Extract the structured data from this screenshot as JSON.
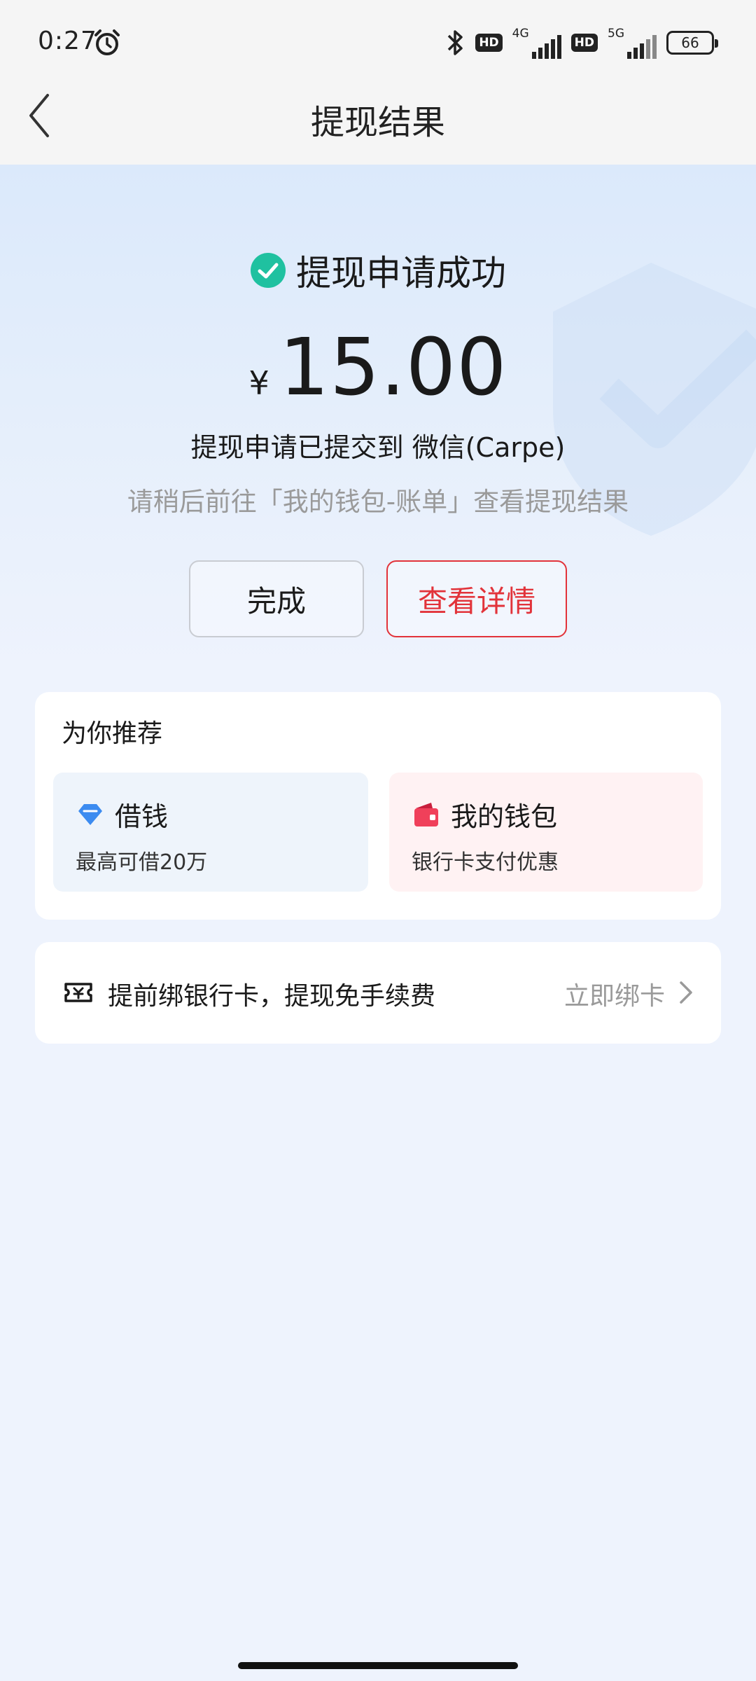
{
  "status_bar": {
    "time": "0:27",
    "hd1": "HD",
    "net1": "4G",
    "hd2": "HD",
    "net2": "5G",
    "battery": "66"
  },
  "nav": {
    "title": "提现结果"
  },
  "result": {
    "status_text": "提现申请成功",
    "currency_symbol": "¥",
    "amount": "15.00",
    "submitted_text": "提现申请已提交到 微信(Carpe)",
    "hint_text": "请稍后前往「我的钱包-账单」查看提现结果"
  },
  "actions": {
    "done_label": "完成",
    "detail_label": "查看详情"
  },
  "recommend": {
    "title": "为你推荐",
    "items": [
      {
        "label": "借钱",
        "sub": "最高可借20万",
        "icon": "diamond-icon"
      },
      {
        "label": "我的钱包",
        "sub": "银行卡支付优惠",
        "icon": "wallet-icon"
      }
    ]
  },
  "bind_card": {
    "text": "提前绑银行卡，提现免手续费",
    "action": "立即绑卡"
  },
  "colors": {
    "accent_red": "#e2333a",
    "success_green": "#1fc1a0",
    "loan_blue": "#3c8bf0",
    "wallet_red": "#f0405a"
  }
}
